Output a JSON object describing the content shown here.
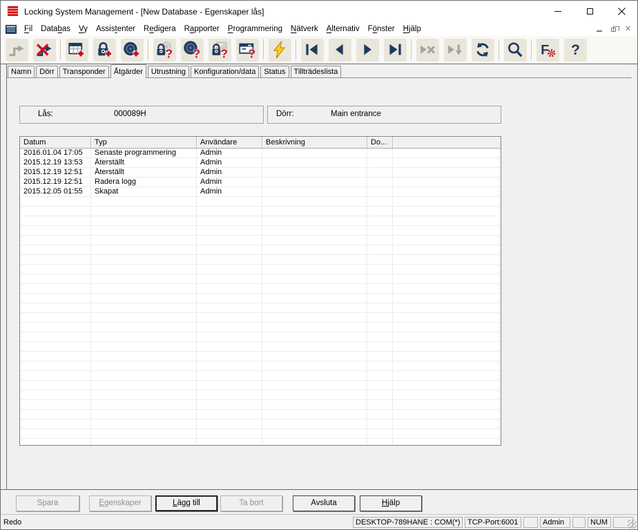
{
  "window": {
    "title": "Locking System Management - [New Database - Egenskaper lås]"
  },
  "titlebar_controls": [
    "minimize",
    "maximize",
    "close"
  ],
  "menubar": {
    "items": [
      {
        "id": "fil",
        "pre": "",
        "accel": "F",
        "post": "il"
      },
      {
        "id": "databas",
        "pre": "Data",
        "accel": "b",
        "post": "as"
      },
      {
        "id": "vy",
        "pre": "",
        "accel": "V",
        "post": "y"
      },
      {
        "id": "assistenter",
        "pre": "Assis",
        "accel": "t",
        "post": "enter"
      },
      {
        "id": "redigera",
        "pre": "R",
        "accel": "e",
        "post": "digera"
      },
      {
        "id": "rapporter",
        "pre": "R",
        "accel": "a",
        "post": "pporter"
      },
      {
        "id": "programmering",
        "pre": "",
        "accel": "P",
        "post": "rogrammering"
      },
      {
        "id": "natverk",
        "pre": "",
        "accel": "N",
        "post": "ätverk"
      },
      {
        "id": "alternativ",
        "pre": "",
        "accel": "A",
        "post": "lternativ"
      },
      {
        "id": "fonster",
        "pre": "F",
        "accel": "ö",
        "post": "nster"
      },
      {
        "id": "hjalp",
        "pre": "",
        "accel": "H",
        "post": "jälp"
      }
    ]
  },
  "toolbar": {
    "items": [
      {
        "name": "connect",
        "icon": "connect-icon",
        "enabled": false
      },
      {
        "name": "disconnect",
        "icon": "disconnect-icon",
        "enabled": true
      },
      {
        "sep": true
      },
      {
        "name": "new-matrix",
        "icon": "new-matrix-icon",
        "enabled": true
      },
      {
        "name": "new-lock",
        "icon": "new-lock-icon",
        "enabled": true
      },
      {
        "name": "new-transponder",
        "icon": "new-transponder-icon",
        "enabled": true
      },
      {
        "sep": true
      },
      {
        "name": "read-lock",
        "icon": "read-lock-icon",
        "enabled": true
      },
      {
        "name": "read-transponder",
        "icon": "read-transponder-icon",
        "enabled": true
      },
      {
        "name": "read-network-lock",
        "icon": "read-network-lock-icon",
        "enabled": true
      },
      {
        "name": "read-window",
        "icon": "read-window-icon",
        "enabled": true
      },
      {
        "sep": true
      },
      {
        "name": "program",
        "icon": "program-icon",
        "enabled": true
      },
      {
        "sep": true
      },
      {
        "name": "nav-first",
        "icon": "nav-first-icon",
        "enabled": true
      },
      {
        "name": "nav-prev",
        "icon": "nav-prev-icon",
        "enabled": true
      },
      {
        "name": "nav-next",
        "icon": "nav-next-icon",
        "enabled": true
      },
      {
        "name": "nav-last",
        "icon": "nav-last-icon",
        "enabled": true
      },
      {
        "sep": true
      },
      {
        "name": "nav-cancel",
        "icon": "nav-cancel-icon",
        "enabled": false
      },
      {
        "name": "nav-down",
        "icon": "nav-down-icon",
        "enabled": false
      },
      {
        "name": "refresh",
        "icon": "refresh-icon",
        "enabled": true
      },
      {
        "sep": true
      },
      {
        "name": "search",
        "icon": "search-icon",
        "enabled": true
      },
      {
        "sep": true
      },
      {
        "name": "filter-settings",
        "icon": "filter-settings-icon",
        "enabled": true
      },
      {
        "name": "help",
        "icon": "help-icon",
        "enabled": true
      }
    ]
  },
  "tabs": {
    "active_index": 3,
    "items": [
      "Namn",
      "Dörr",
      "Transponder",
      "Åtgärder",
      "Utrustning",
      "Konfiguration/data",
      "Status",
      "Tillträdeslista"
    ]
  },
  "fields": {
    "lock": {
      "label": "Lås:",
      "value": "000089H"
    },
    "door": {
      "label": "Dörr:",
      "value": "Main entrance"
    }
  },
  "table": {
    "columns": [
      "Datum",
      "Typ",
      "Användare",
      "Beskrivning",
      "Do...",
      ""
    ],
    "rows": [
      [
        "2016.01.04 17:05",
        "Senaste programmering",
        "Admin",
        "",
        "",
        ""
      ],
      [
        "2015.12.19 13:53",
        "Återställt",
        "Admin",
        "",
        "",
        ""
      ],
      [
        "2015.12.19 12:51",
        "Återställt",
        "Admin",
        "",
        "",
        ""
      ],
      [
        "2015.12.19 12:51",
        "Radera logg",
        "Admin",
        "",
        "",
        ""
      ],
      [
        "2015.12.05 01:55",
        "Skapat",
        "Admin",
        "",
        "",
        ""
      ]
    ]
  },
  "footer": {
    "buttons": [
      {
        "id": "spara",
        "pre": "Spara",
        "accel": "",
        "post": "",
        "enabled": false,
        "default": false
      },
      {
        "id": "egenskaper",
        "pre": "",
        "accel": "E",
        "post": "genskaper",
        "enabled": false,
        "default": false
      },
      {
        "id": "lagg-till",
        "pre": "",
        "accel": "L",
        "post": "ägg till",
        "enabled": true,
        "default": true
      },
      {
        "id": "ta-bort",
        "pre": "Ta bort",
        "accel": "",
        "post": "",
        "enabled": false,
        "default": false
      },
      {
        "id": "avsluta",
        "pre": "Avsluta",
        "accel": "",
        "post": "",
        "enabled": true,
        "default": false
      },
      {
        "id": "hjalp",
        "pre": "",
        "accel": "H",
        "post": "jälp",
        "enabled": true,
        "default": false
      }
    ]
  },
  "statusbar": {
    "message": "Redo",
    "sections": [
      "DESKTOP-789HANE : COM(*)",
      "TCP-Port:6001",
      "",
      "Admin",
      "",
      "NUM",
      ""
    ]
  },
  "colors": {
    "navy": "#1d3a5f",
    "red": "#c41425",
    "yellow": "#ffd21e",
    "gray_disabled": "#a4a49e",
    "logo_red": "#d20a0a",
    "toolbar_button_bg": "#e9e6db"
  }
}
